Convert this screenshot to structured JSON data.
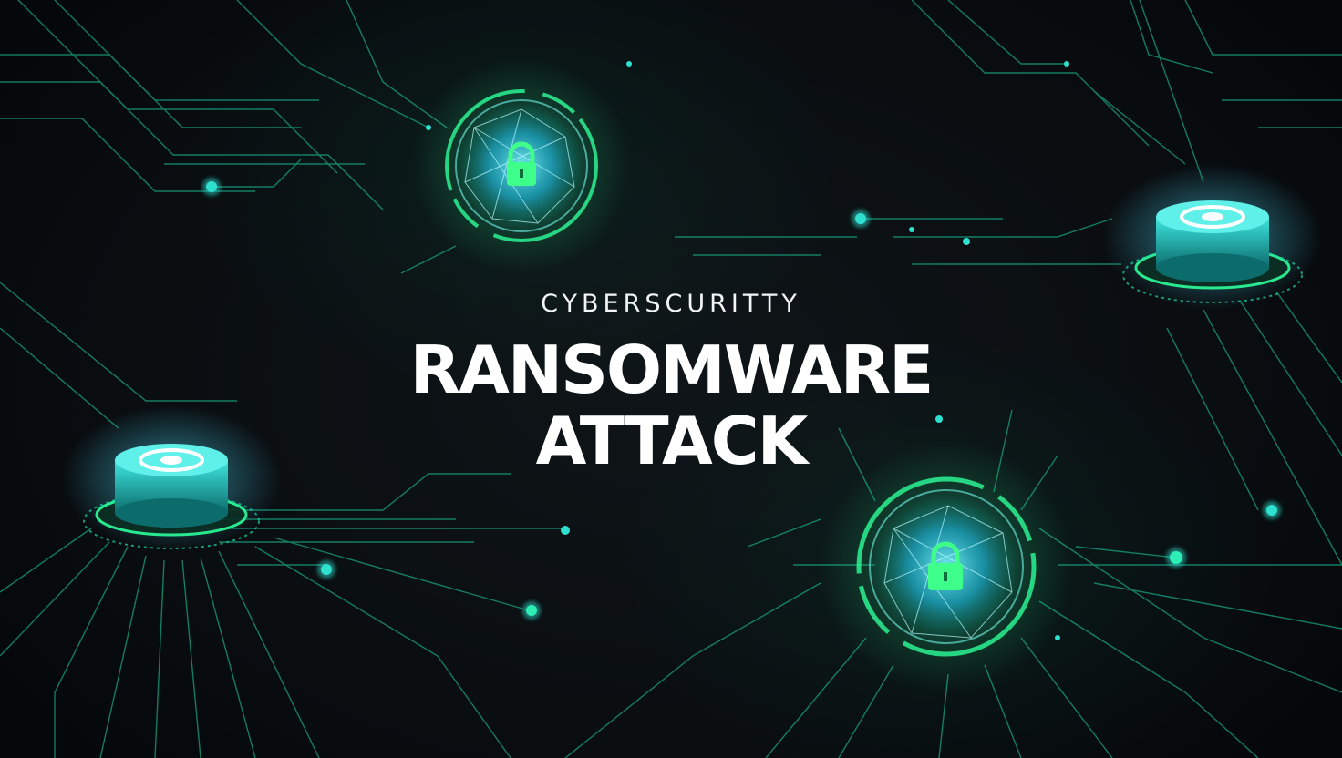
{
  "headline": {
    "kicker": "CYBERSCURITTY",
    "line1": "RANSOMWARE",
    "line2": "ATTACK"
  },
  "colors": {
    "background": "#0a0f12",
    "circuit": "#1fd6a8",
    "glow_green": "#2cff9a",
    "glow_cyan": "#32c8ff",
    "text": "#ffffff"
  },
  "icons": [
    "lock-icon",
    "lock-icon",
    "target-button-icon",
    "target-button-icon"
  ]
}
